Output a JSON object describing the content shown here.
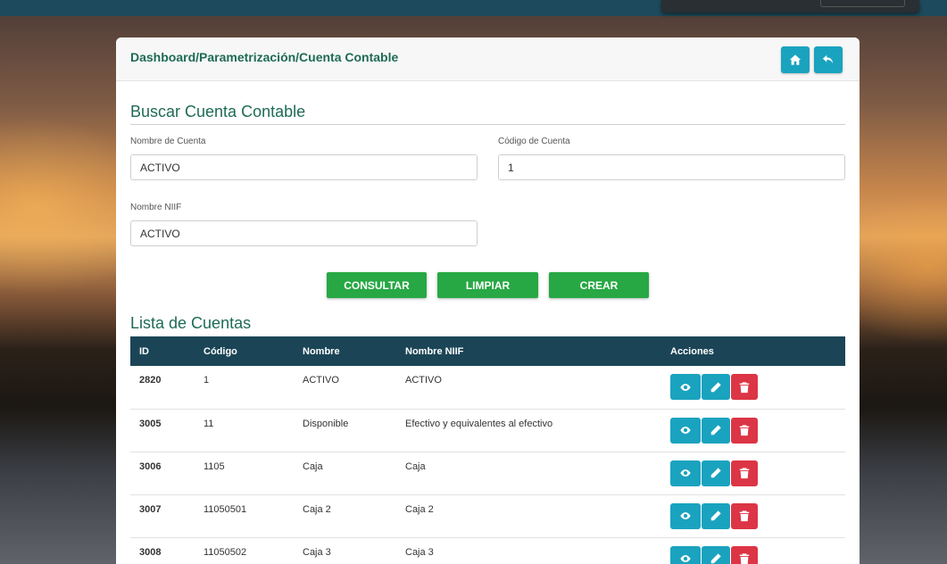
{
  "breadcrumb": "Dashboard/Parametrización/Cuenta Contable",
  "search": {
    "title": "Buscar Cuenta Contable",
    "nombre_label": "Nombre de Cuenta",
    "nombre_value": "ACTIVO",
    "codigo_label": "Código de Cuenta",
    "codigo_value": "1",
    "niif_label": "Nombre NIIF",
    "niif_value": "ACTIVO"
  },
  "buttons": {
    "consultar": "CONSULTAR",
    "limpiar": "LIMPIAR",
    "crear": "CREAR"
  },
  "list": {
    "title": "Lista de Cuentas",
    "headers": [
      "ID",
      "Código",
      "Nombre",
      "Nombre NIIF",
      "Acciones"
    ],
    "rows": [
      {
        "id": "2820",
        "codigo": "1",
        "nombre": "ACTIVO",
        "niif": "ACTIVO"
      },
      {
        "id": "3005",
        "codigo": "11",
        "nombre": "Disponible",
        "niif": "Efectivo y equivalentes al efectivo"
      },
      {
        "id": "3006",
        "codigo": "1105",
        "nombre": "Caja",
        "niif": "Caja"
      },
      {
        "id": "3007",
        "codigo": "11050501",
        "nombre": "Caja 2",
        "niif": "Caja 2"
      },
      {
        "id": "3008",
        "codigo": "11050502",
        "nombre": "Caja 3",
        "niif": "Caja 3"
      }
    ]
  },
  "icons": {
    "home": "home-icon",
    "back": "back-arrow-icon",
    "view": "eye-icon",
    "edit": "pencil-icon",
    "delete": "trash-icon"
  },
  "colors": {
    "accent_teal": "#1aa3bf",
    "green": "#27a844",
    "danger": "#dc3545",
    "table_header": "#1b4556",
    "title_green": "#1e6b55"
  }
}
